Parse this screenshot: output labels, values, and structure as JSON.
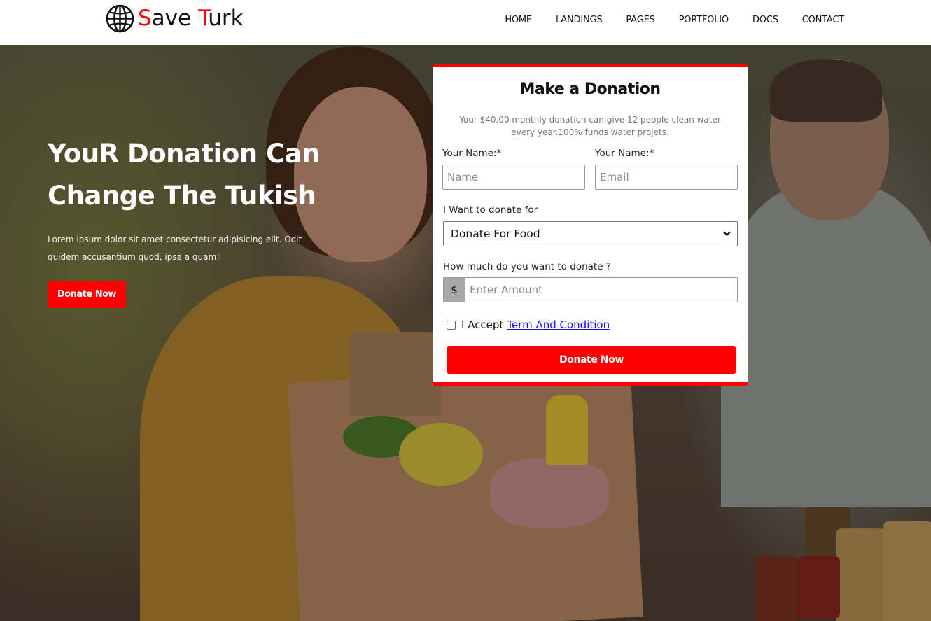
{
  "brand": {
    "part1_red": "S",
    "part2": "ave ",
    "part3_red": "T",
    "part4": "urk",
    "logo_icon": "globe-icon"
  },
  "nav": {
    "items": [
      "HOME",
      "LANDINGS",
      "PAGES",
      "PORTFOLIO",
      "DOCS",
      "CONTACT"
    ]
  },
  "hero": {
    "title_line1": "YouR Donation Can",
    "title_line2": "Change The Tukish",
    "text": "Lorem ipsum dolor sit amet consectetur adipisicing elit. Odit quidem accusantium quod, ipsa a quam!",
    "button_label": "Donate Now"
  },
  "donation_form": {
    "title": "Make a Donation",
    "description": "Your $40.00 monthly donation can give 12 people clean water every year.100% funds water projets.",
    "name_label": "Your Name:*",
    "name_placeholder": "Name",
    "email_label": "Your Name:*",
    "email_placeholder": "Email",
    "donate_for_label": "I Want to donate for",
    "donate_for_selected": "Donate For Food",
    "amount_label": "How much do you want to donate ?",
    "currency_symbol": "$",
    "amount_placeholder": "Enter Amount",
    "accept_text": "I Accept",
    "accept_link": "Term And Condition",
    "submit_label": "Donate Now"
  },
  "colors": {
    "accent": "#ff0000",
    "link": "#1a0dff"
  }
}
